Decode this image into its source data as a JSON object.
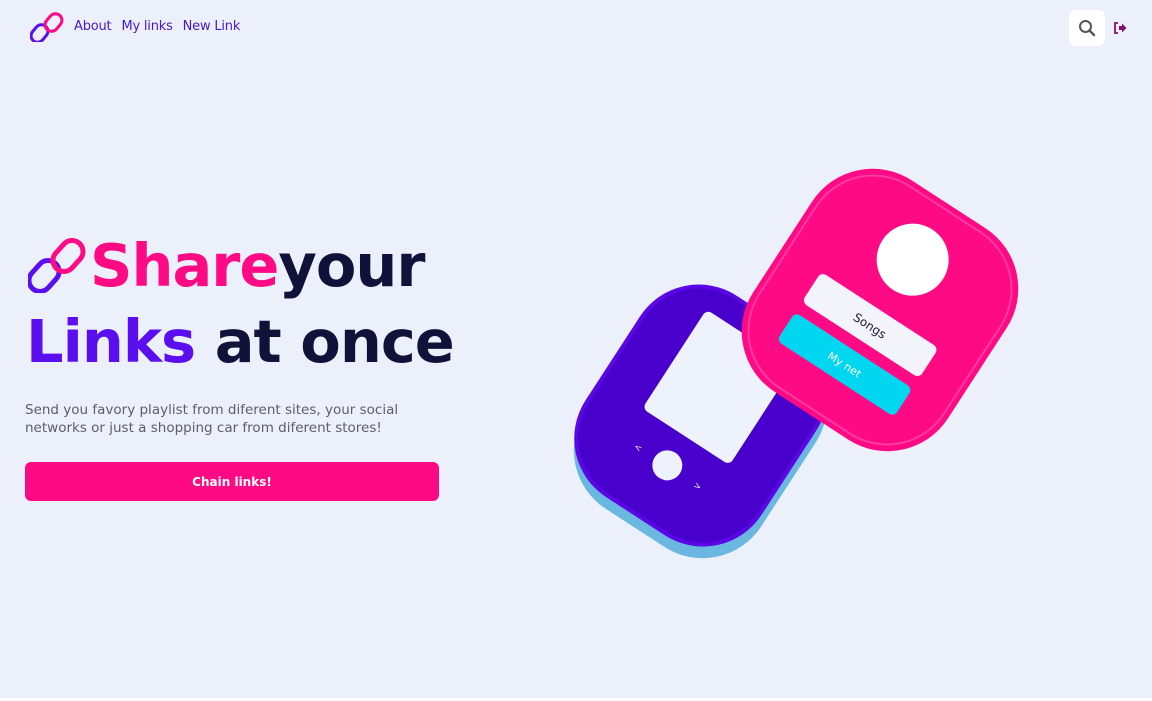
{
  "nav": {
    "logo_icon": "chain-link-icon",
    "links": [
      "About",
      "My links",
      "New Link"
    ],
    "search_icon": "search-icon",
    "logout_icon": "logout-icon"
  },
  "hero": {
    "headline_word1": "Share",
    "headline_word2": "your",
    "headline_word3": "Links",
    "headline_word4": " at once",
    "subtitle": "Send you favory playlist from diferent sites, your social networks or just a shopping car from diferent stores!",
    "cta_label": "Chain links!"
  },
  "illustration": {
    "card_songs": "Songs",
    "card_mynet": "My net",
    "prev_arrow": "<",
    "next_arrow": ">"
  },
  "colors": {
    "brand_pink": "#ff0a85",
    "brand_purple": "#5b0ff0",
    "dark_text": "#11123a",
    "cyan": "#00d6ef",
    "background": "#ecf0fa"
  }
}
